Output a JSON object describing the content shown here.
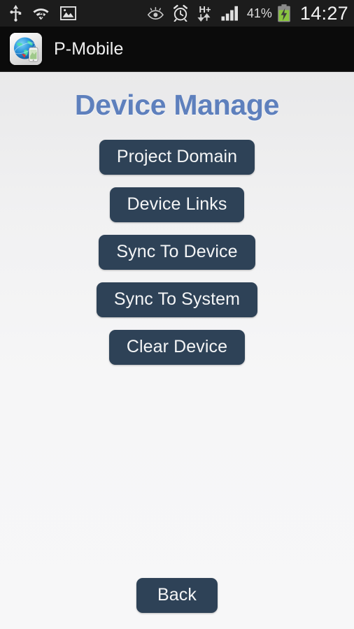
{
  "status_bar": {
    "left_icons": [
      {
        "name": "usb-icon",
        "label": "USB connected"
      },
      {
        "name": "wifi-question-icon",
        "label": "Wi-Fi no internet"
      },
      {
        "name": "screenshot-image-icon",
        "label": "Screenshot captured"
      }
    ],
    "right_icons": [
      {
        "name": "smart-stay-eye-icon",
        "label": "Smart stay"
      },
      {
        "name": "alarm-clock-icon",
        "label": "Alarm set"
      },
      {
        "name": "hsdpa-data-icon",
        "label": "H+"
      },
      {
        "name": "signal-bars-icon",
        "label": "Signal strength"
      }
    ],
    "data_type_label": "H+",
    "battery_percent": "41%",
    "battery_state": "charging",
    "clock": "14:27"
  },
  "action_bar": {
    "app_icon_name": "globe-phone-app-icon",
    "title": "P-Mobile"
  },
  "screen": {
    "title": "Device Manage",
    "title_color": "#5e80bd",
    "button_color": "#2e4257",
    "button_text_color": "#f4f5f6",
    "background_color": "#f6f6f7",
    "menu_buttons": [
      {
        "label": "Project Domain",
        "name": "project-domain-button"
      },
      {
        "label": "Device Links",
        "name": "device-links-button"
      },
      {
        "label": "Sync To Device",
        "name": "sync-to-device-button"
      },
      {
        "label": "Sync To System",
        "name": "sync-to-system-button"
      },
      {
        "label": "Clear Device",
        "name": "clear-device-button"
      }
    ],
    "back_button": {
      "label": "Back",
      "name": "back-button"
    }
  }
}
